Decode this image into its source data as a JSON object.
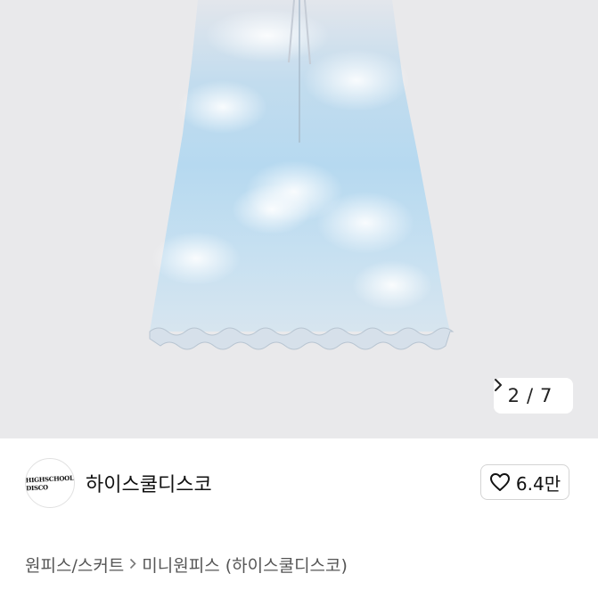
{
  "gallery": {
    "current": "2",
    "total": "7",
    "separator": "/",
    "next_icon": "chevron-right-icon"
  },
  "shop": {
    "name": "하이스쿨디스코",
    "avatar_logo": "HIGHSCHOOL DISCO logo",
    "likes": "6.4만",
    "like_icon": "heart-outline-icon"
  },
  "breadcrumb": {
    "category": "원피스/스커트",
    "subcategory": "미니원피스 (하이스쿨디스코)",
    "separator_icon": "chevron-right-icon"
  },
  "colors": {
    "photo_bg": "#e9e9eb",
    "dress_blue": "#b9dcf2",
    "dress_white": "#f2f4f7"
  }
}
